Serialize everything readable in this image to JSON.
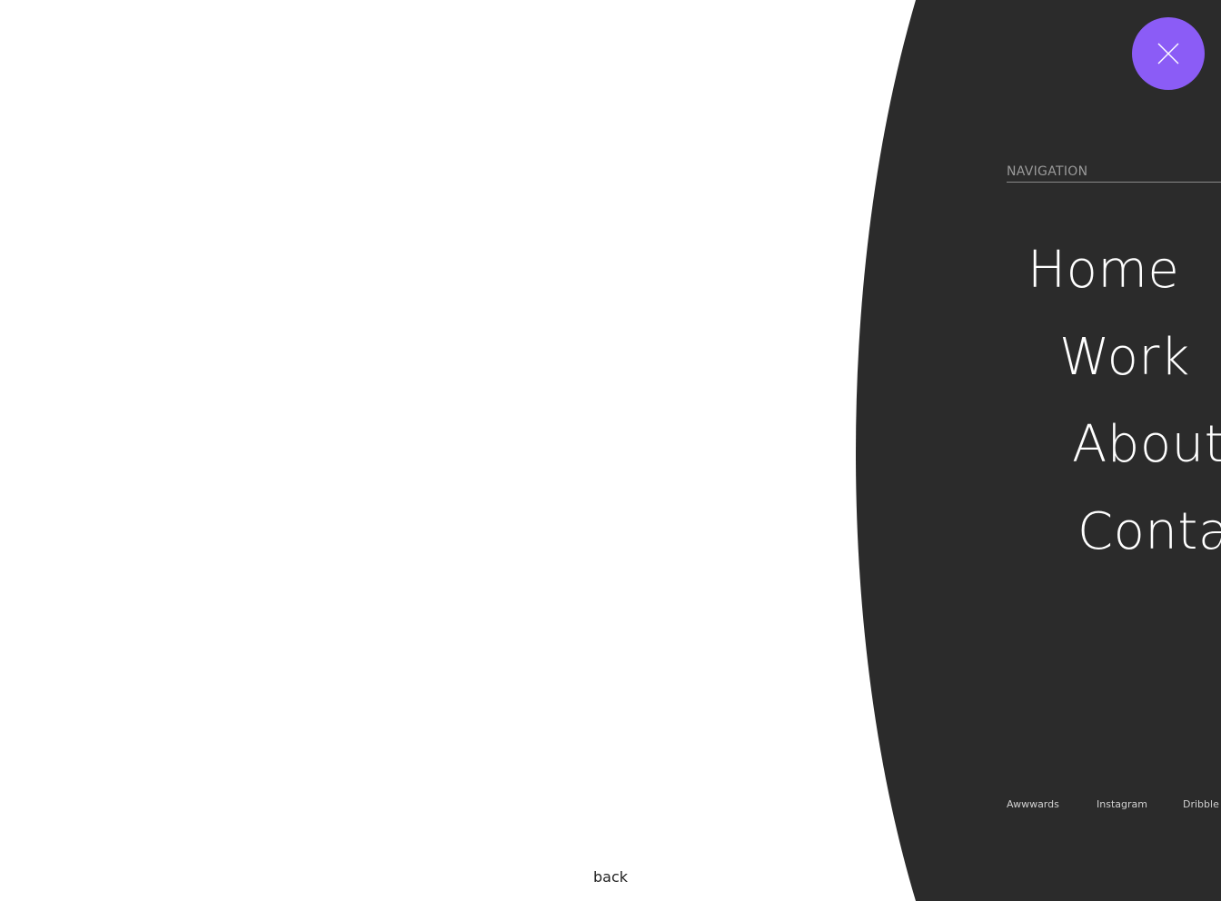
{
  "page": {
    "back_label": "back"
  },
  "menu": {
    "close_icon": "close-icon",
    "accent_color": "#8b5cf6",
    "panel_color": "#2b2b2b",
    "heading": "NAVIGATION",
    "items": [
      {
        "label": "Home"
      },
      {
        "label": "Work"
      },
      {
        "label": "About"
      },
      {
        "label": "Contact"
      }
    ],
    "social": [
      {
        "label": "Awwwards"
      },
      {
        "label": "Instagram"
      },
      {
        "label": "Dribble"
      }
    ]
  }
}
